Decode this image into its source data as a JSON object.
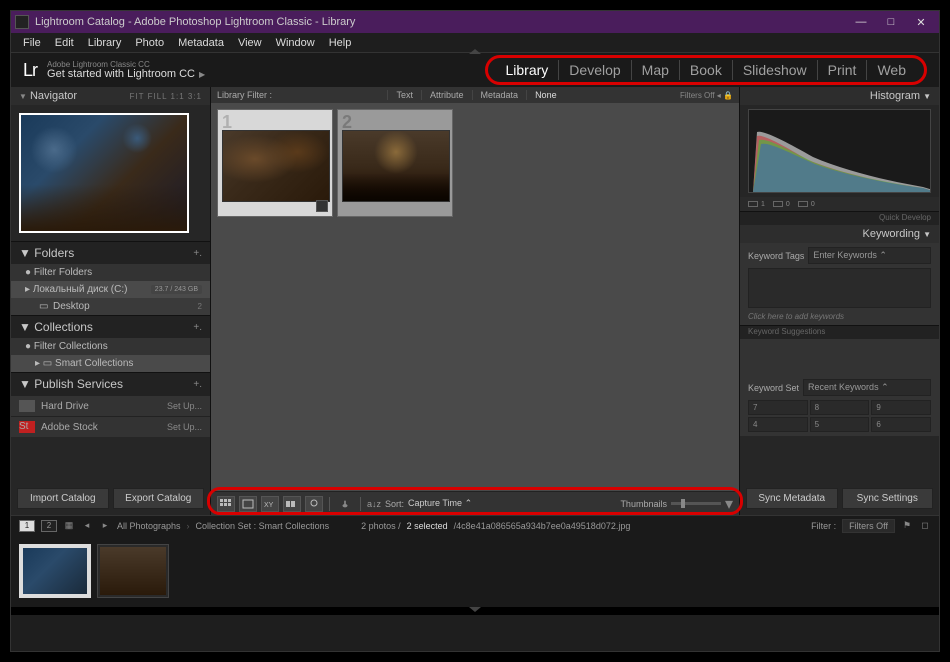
{
  "window_title": "Lightroom Catalog - Adobe Photoshop Lightroom Classic - Library",
  "menubar": [
    "File",
    "Edit",
    "Library",
    "Photo",
    "Metadata",
    "View",
    "Window",
    "Help"
  ],
  "hero": {
    "logo": "Lr",
    "sub_small": "Adobe Lightroom Classic CC",
    "sub_main": "Get started with Lightroom CC"
  },
  "modules": [
    "Library",
    "Develop",
    "Map",
    "Book",
    "Slideshow",
    "Print",
    "Web"
  ],
  "active_module": "Library",
  "navigator": {
    "title": "Navigator",
    "opts": "FIT  FILL  1:1  3:1"
  },
  "folders": {
    "title": "Folders",
    "filter": "Filter Folders",
    "drive": "Локальный диск (C:)",
    "drive_usage": "23.7 / 243 GB",
    "items": [
      {
        "name": "Desktop",
        "count": "2"
      }
    ]
  },
  "collections": {
    "title": "Collections",
    "filter": "Filter Collections",
    "items": [
      {
        "name": "Smart Collections"
      }
    ]
  },
  "publish": {
    "title": "Publish Services",
    "items": [
      {
        "name": "Hard Drive",
        "action": "Set Up..."
      },
      {
        "name": "Adobe Stock",
        "action": "Set Up..."
      }
    ]
  },
  "import_btn": "Import Catalog",
  "export_btn": "Export Catalog",
  "filter_bar": {
    "label": "Library Filter :",
    "opts": [
      "Text",
      "Attribute",
      "Metadata",
      "None"
    ],
    "active": "None",
    "lock": "Filters Off"
  },
  "toolbar": {
    "sort_label": "Sort:",
    "sort_value": "Capture Time",
    "thumb_label": "Thumbnails"
  },
  "right": {
    "histogram": "Histogram",
    "histo_chips": [
      "1",
      "0",
      "0"
    ],
    "quick_develop": "Quick Develop",
    "keywording": {
      "title": "Keywording",
      "tags_label": "Keyword Tags",
      "tags_value": "Enter Keywords",
      "hint": "Click here to add keywords",
      "suggestions": "Keyword Suggestions",
      "set_label": "Keyword Set",
      "set_value": "Recent Keywords"
    },
    "kw_nums1": [
      "7",
      "8",
      "9"
    ],
    "kw_nums2": [
      "4",
      "5",
      "6"
    ],
    "sync_meta": "Sync Metadata",
    "sync_settings": "Sync Settings"
  },
  "status": {
    "pages": [
      "1",
      "2"
    ],
    "path": "All Photographs",
    "path2": "Collection Set : Smart Collections",
    "count": "2 photos /",
    "selected": "2 selected",
    "hash": "/4c8e41a086565a934b7ee0a49518d072.jpg",
    "filter_label": "Filter :",
    "filter_value": "Filters Off"
  }
}
